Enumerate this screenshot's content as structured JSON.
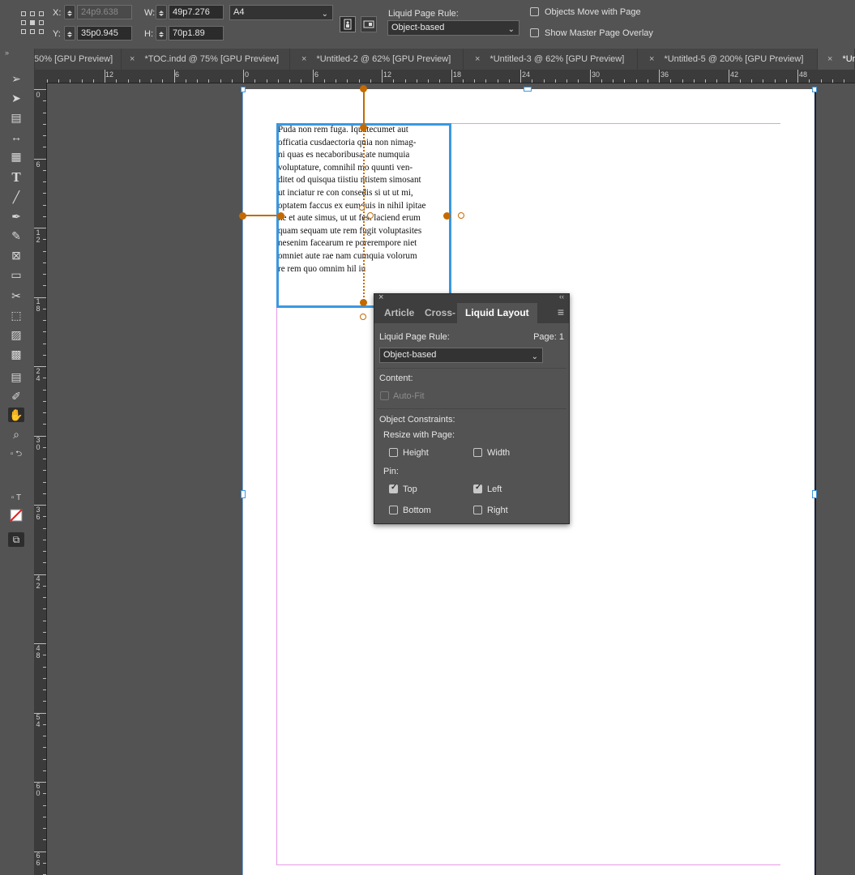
{
  "control_bar": {
    "x_label": "X:",
    "x_value": "24p9.638",
    "y_label": "Y:",
    "y_value": "35p0.945",
    "w_label": "W:",
    "w_value": "49p7.276",
    "h_label": "H:",
    "h_value": "70p1.89",
    "page_size": "A4",
    "liquid_rule_label": "Liquid Page Rule:",
    "liquid_rule_value": "Object-based",
    "objects_move_label": "Objects Move with Page",
    "objects_move_checked": false,
    "master_overlay_label": "Show Master Page Overlay",
    "master_overlay_checked": false
  },
  "tabs": [
    {
      "label": "50% [GPU Preview]",
      "close": "",
      "active": false
    },
    {
      "label": "*TOC.indd @ 75% [GPU Preview]",
      "close": "×",
      "active": false
    },
    {
      "label": "*Untitled-2 @ 62% [GPU Preview]",
      "close": "×",
      "active": false
    },
    {
      "label": "*Untitled-3 @ 62% [GPU Preview]",
      "close": "×",
      "active": false
    },
    {
      "label": "*Untitled-5 @ 200% [GPU Preview]",
      "close": "×",
      "active": false
    },
    {
      "label": "*Ur",
      "close": "×",
      "active": true
    }
  ],
  "ruler": {
    "h_labels": [
      "12",
      "6",
      "0",
      "6",
      "12",
      "18",
      "24",
      "30",
      "36",
      "42",
      "48"
    ],
    "v_labels": [
      "0",
      "6",
      "1 2",
      "1 8",
      "2 4",
      "3 0",
      "3 6",
      "4 2",
      "4 8",
      "5 4",
      "6 0",
      "6 6"
    ]
  },
  "story_lines": [
    "Puda non rem fuga. Iquatecumet aut",
    "officatia cusdaectoria quia non nimag-",
    "ni quas es necaboribusa ate numquia",
    "voluptature, comnihil mo quunti ven-",
    "ditet od quisqua tiistiu ntistem simosant",
    "ut inciatur re con consedis si ut ut mi,",
    "optatem faccus ex eumquis in nihil ipitae",
    "ne et aute simus, ut ut fest laciend erum",
    "quam sequam ute rem fugit voluptasites",
    "nesenim facearum re porerempore niet",
    "omniet aute rae nam cumquia volorum",
    "re rem quo omnim hil iu"
  ],
  "panel": {
    "close": "×",
    "collapse": "‹‹",
    "tabs": [
      "Article",
      "Cross-",
      "Liquid Layout"
    ],
    "menu": "≡",
    "rule_label": "Liquid Page Rule:",
    "page_label": "Page: 1",
    "rule_value": "Object-based",
    "content_label": "Content:",
    "autofit_label": "Auto-Fit",
    "constraints_label": "Object Constraints:",
    "resize_label": "Resize with Page:",
    "height_label": "Height",
    "width_label": "Width",
    "pin_label": "Pin:",
    "top_label": "Top",
    "left_label": "Left",
    "bottom_label": "Bottom",
    "right_label": "Right",
    "checks": {
      "autofit": false,
      "height": false,
      "width": false,
      "top": true,
      "left": true,
      "bottom": false,
      "right": false
    }
  },
  "colors": {
    "frame_selection": "#3a98e0",
    "liquid_guides": "#c46a00",
    "margin_guides": "#e89ae8"
  }
}
